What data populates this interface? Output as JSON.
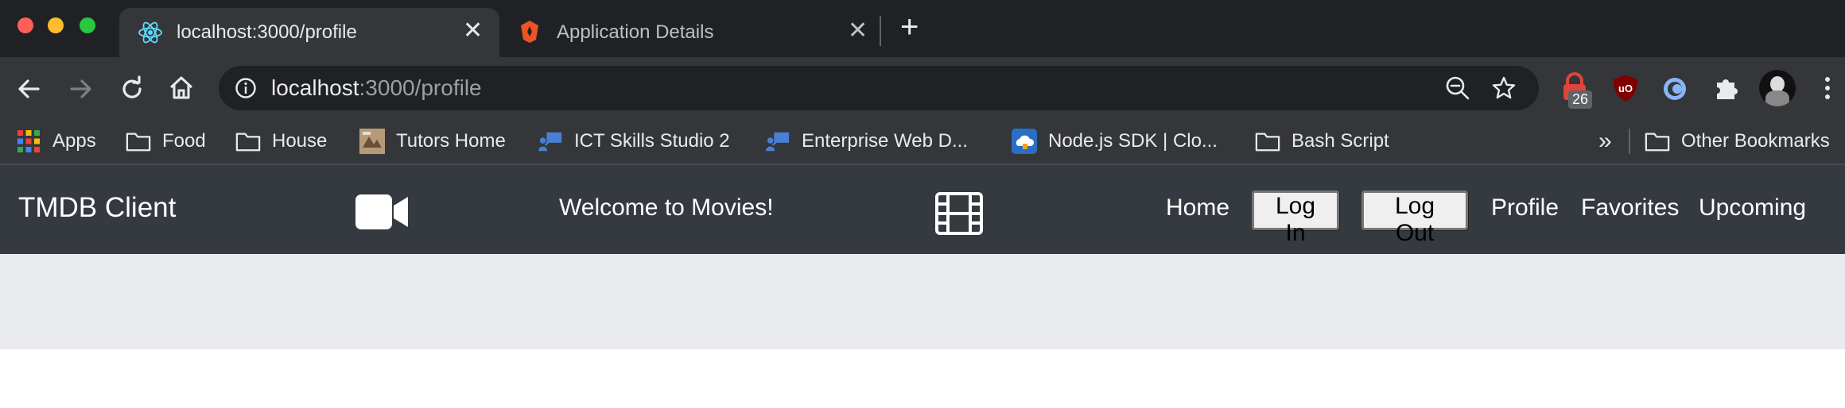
{
  "browser": {
    "tabs": [
      {
        "title": "localhost:3000/profile",
        "active": true,
        "icon": "react-icon"
      },
      {
        "title": "Application Details",
        "active": false,
        "icon": "auth0-icon"
      }
    ],
    "address": {
      "host": "localhost",
      "rest": ":3000/profile"
    },
    "extension_badge": "26",
    "bookmarks": [
      {
        "label": "Apps",
        "icon": "apps-grid-icon"
      },
      {
        "label": "Food",
        "icon": "folder-icon"
      },
      {
        "label": "House",
        "icon": "folder-icon"
      },
      {
        "label": "Tutors Home",
        "icon": "tutors-favicon"
      },
      {
        "label": "ICT Skills Studio 2",
        "icon": "studio-favicon"
      },
      {
        "label": "Enterprise Web D...",
        "icon": "studio-favicon"
      },
      {
        "label": "Node.js SDK | Clo...",
        "icon": "cloud-favicon"
      },
      {
        "label": "Bash Script",
        "icon": "folder-icon"
      }
    ],
    "overflow": "»",
    "other_bookmarks": "Other Bookmarks"
  },
  "app": {
    "brand": "TMDB Client",
    "welcome": "Welcome to Movies!",
    "nav": {
      "home": "Home",
      "login": "Log In",
      "logout": "Log Out",
      "profile": "Profile",
      "favorites": "Favorites",
      "upcoming": "Upcoming"
    }
  },
  "colors": {
    "nav_bg": "#343a40",
    "band_bg": "#e9eaee",
    "chrome_dark": "#202124",
    "chrome_mid": "#35363a"
  }
}
